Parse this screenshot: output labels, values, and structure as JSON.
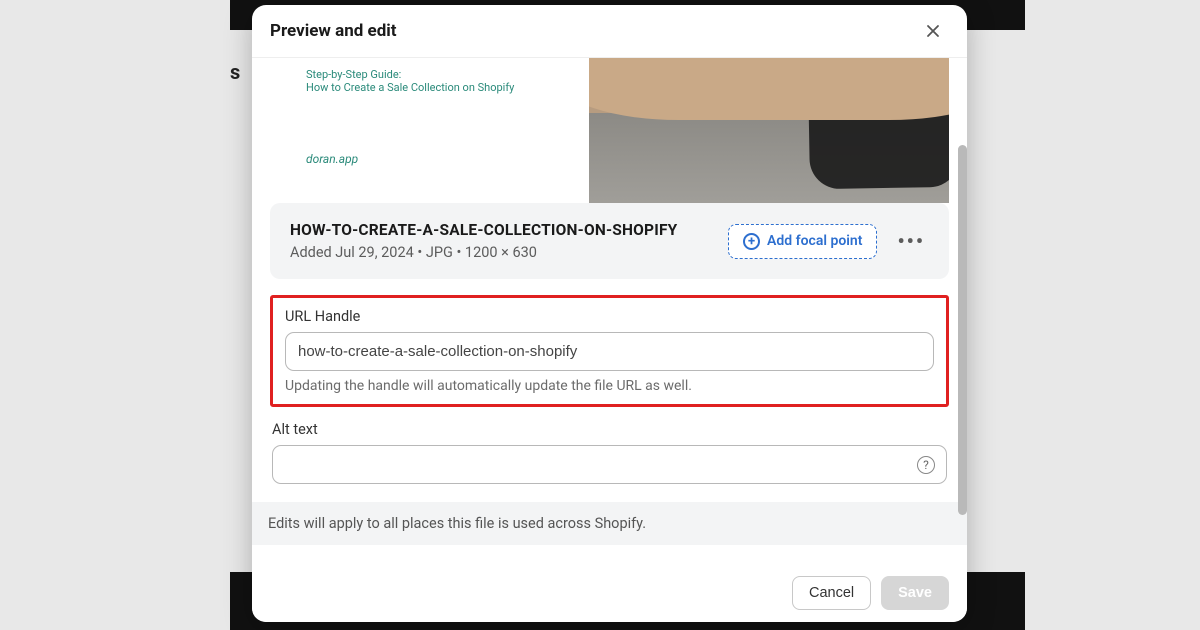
{
  "modal": {
    "title": "Preview and edit"
  },
  "preview": {
    "line1": "Step-by-Step Guide:",
    "line2": "How to Create a Sale Collection on Shopify",
    "brand": "doran.app"
  },
  "file": {
    "name": "HOW-TO-CREATE-A-SALE-COLLECTION-ON-SHOPIFY",
    "meta": "Added Jul 29, 2024 • JPG • 1200 × 630",
    "focal_label": "Add focal point"
  },
  "url_handle": {
    "label": "URL Handle",
    "value": "how-to-create-a-sale-collection-on-shopify",
    "help": "Updating the handle will automatically update the file URL as well."
  },
  "alt_text": {
    "label": "Alt text",
    "value": ""
  },
  "banner": "Edits will apply to all places this file is used across Shopify.",
  "footer": {
    "cancel": "Cancel",
    "save": "Save"
  }
}
